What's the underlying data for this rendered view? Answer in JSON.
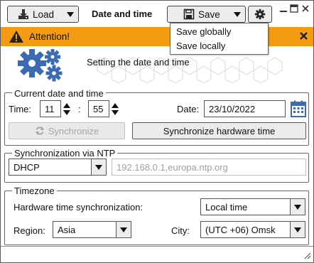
{
  "toolbar": {
    "load_label": "Load",
    "title": "Date and time",
    "save_label": "Save"
  },
  "save_menu": {
    "items": [
      "Save globally",
      "Save locally"
    ]
  },
  "banner": {
    "text": "Attention!",
    "color": "#f39c12"
  },
  "hero": {
    "text": "Setting the date and time"
  },
  "datetime": {
    "legend": "Current date and time",
    "time_label": "Time:",
    "hours": "11",
    "separator": ":",
    "minutes": "55",
    "date_label": "Date:",
    "date_value": "23/10/2022",
    "sync_label": "Synchronize",
    "sync_hw_label": "Synchronize hardware time"
  },
  "ntp": {
    "legend": "Synchronization via NTP",
    "mode": "DHCP",
    "servers_placeholder": "192.168.0.1,europa.ntp.org"
  },
  "timezone": {
    "legend": "Timezone",
    "hw_sync_label": "Hardware time synchronization:",
    "hw_sync_value": "Local time",
    "region_label": "Region:",
    "region_value": "Asia",
    "city_label": "City:",
    "city_value": "(UTC +06) Omsk"
  },
  "icons": {
    "accent_blue": "#3a6bb3"
  }
}
